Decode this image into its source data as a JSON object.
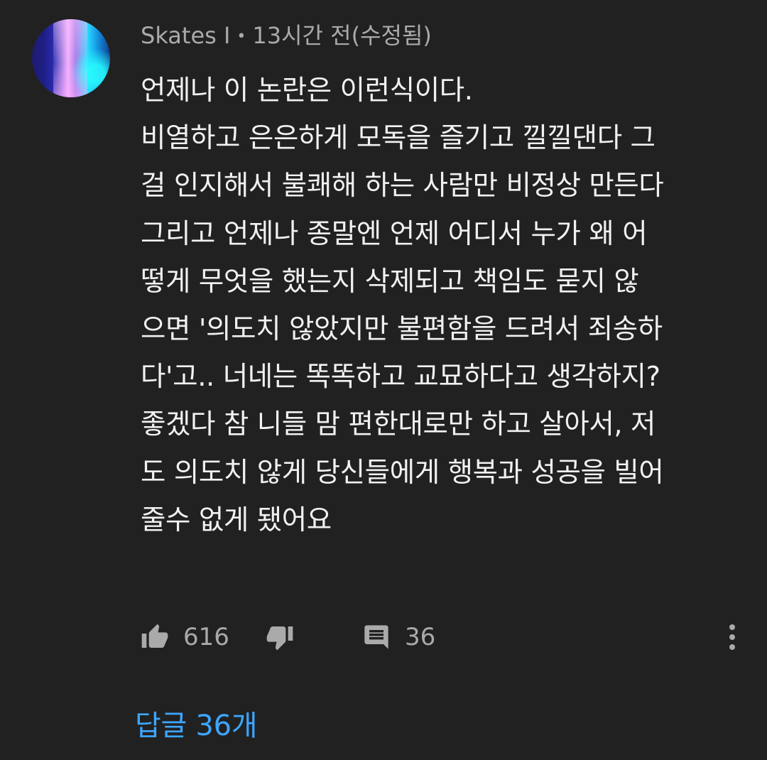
{
  "comment": {
    "author": "Skates I",
    "time": "13시간 전(수정됨)",
    "meta_separator": "•",
    "lines": [
      "언제나 이 논란은 이런식이다.",
      "비열하고 은은하게 모독을 즐기고 낄낄댄다 그",
      "걸 인지해서 불쾌해 하는 사람만 비정상 만든다",
      "그리고 언제나 종말엔 언제 어디서 누가 왜 어",
      "떻게 무엇을 했는지 삭제되고 책임도 묻지 않",
      "으면 '의도치 않았지만 불편함을 드려서 죄송하",
      "다'고.. 너네는 똑똑하고 교묘하다고 생각하지?",
      "좋겠다 참 니들 맘 편한대로만 하고 살아서, 저",
      "도 의도치 않게 당신들에게 행복과 성공을 빌어",
      "줄수 없게 됐어요"
    ]
  },
  "actions": {
    "like_icon": "thumbs-up-icon",
    "like_count": "616",
    "dislike_icon": "thumbs-down-icon",
    "reply_icon": "comment-icon",
    "reply_count": "36",
    "more_icon": "more-vert-icon"
  },
  "replies": {
    "label": "답글 36개"
  },
  "colors": {
    "background": "#212121",
    "text": "#f1f1f1",
    "secondary": "#aaaaaa",
    "link": "#3ea6ff"
  }
}
